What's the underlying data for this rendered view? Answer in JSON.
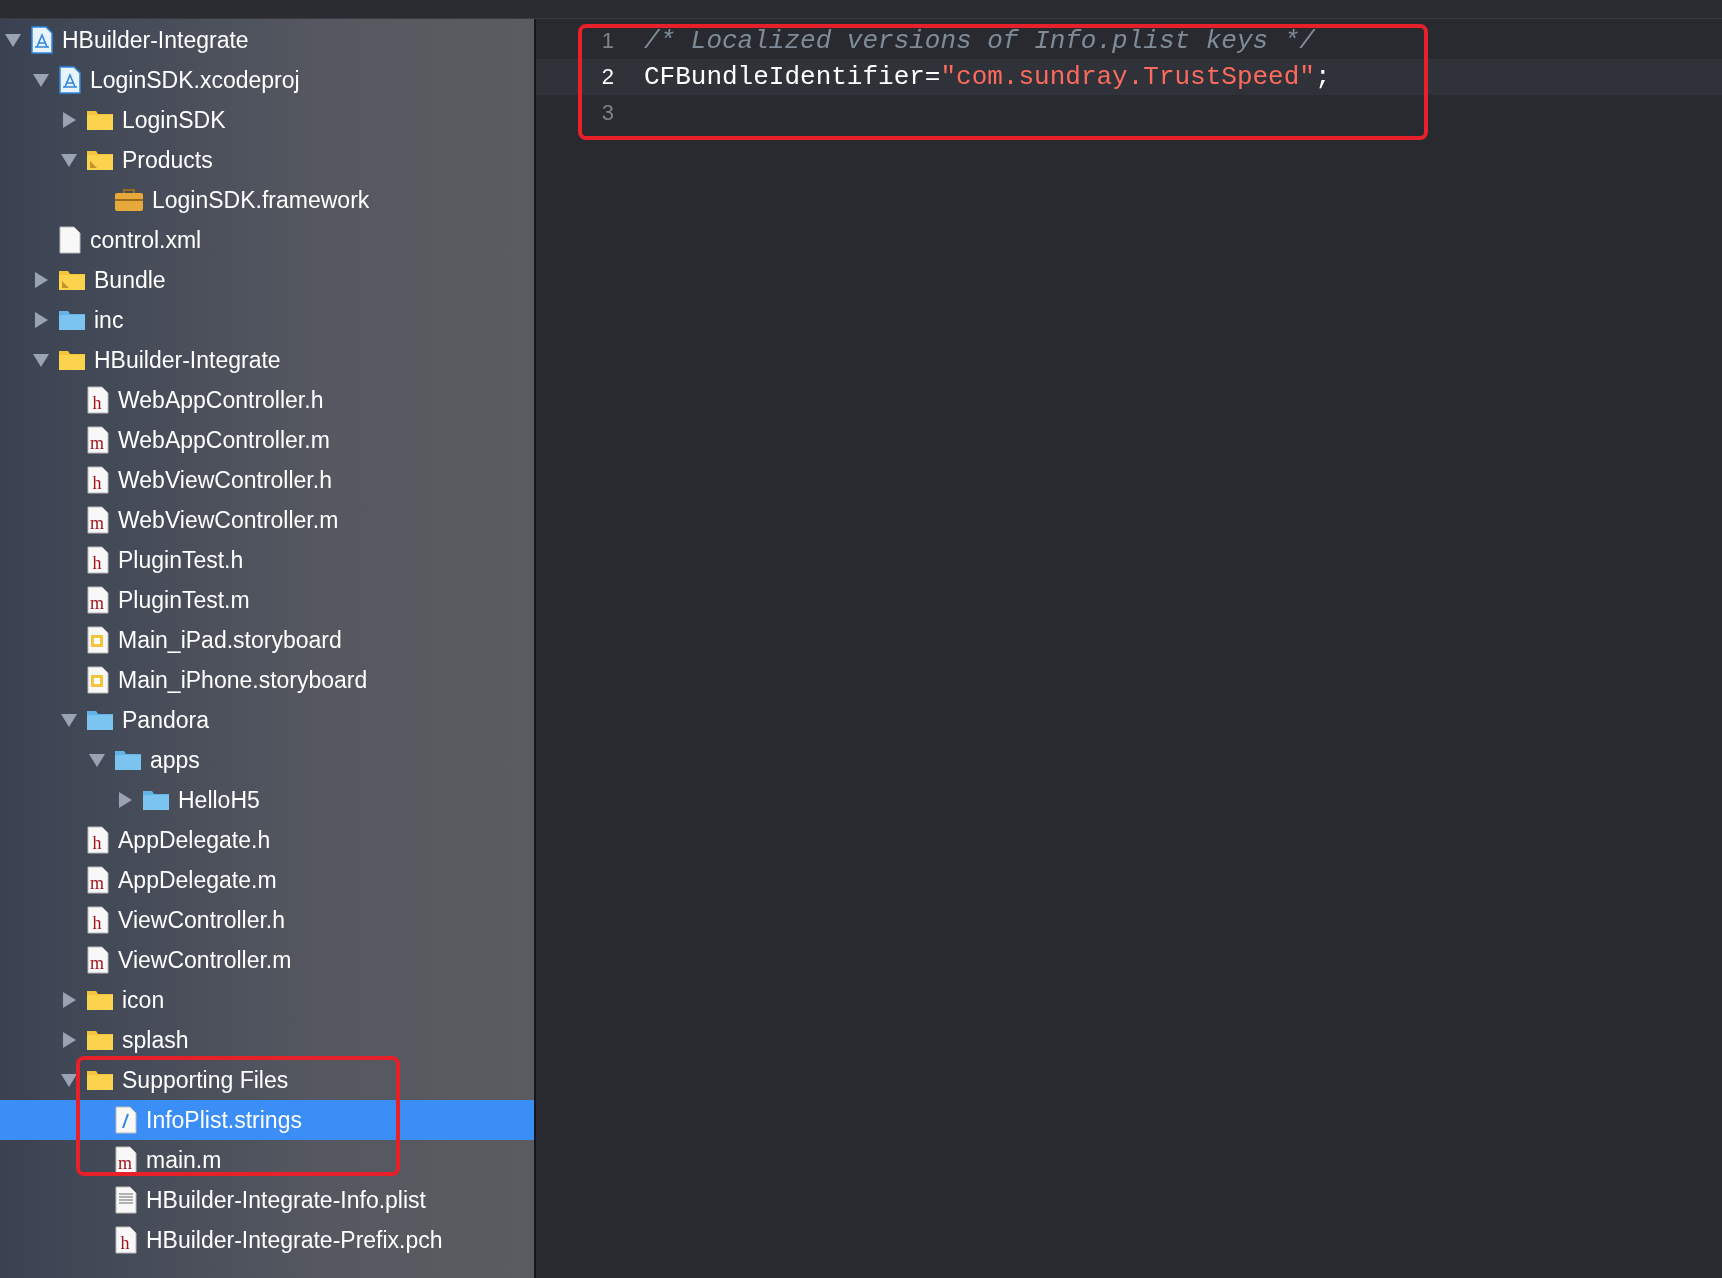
{
  "navigator": {
    "tree": [
      {
        "label": "HBuilder-Integrate",
        "kind": "project",
        "expanded": true,
        "selected": false,
        "children": [
          {
            "label": "LoginSDK.xcodeproj",
            "kind": "project",
            "expanded": true,
            "selected": false,
            "children": [
              {
                "label": "LoginSDK",
                "kind": "folder",
                "expanded": false,
                "selected": false
              },
              {
                "label": "Products",
                "kind": "group",
                "expanded": true,
                "selected": false,
                "children": [
                  {
                    "label": "LoginSDK.framework",
                    "kind": "framework",
                    "selected": false
                  }
                ]
              }
            ]
          },
          {
            "label": "control.xml",
            "kind": "file",
            "selected": false
          },
          {
            "label": "Bundle",
            "kind": "group",
            "expanded": false,
            "selected": false
          },
          {
            "label": "inc",
            "kind": "blue-folder",
            "expanded": false,
            "selected": false
          },
          {
            "label": "HBuilder-Integrate",
            "kind": "folder",
            "expanded": true,
            "selected": false,
            "children": [
              {
                "label": "WebAppController.h",
                "kind": "source",
                "icon_letter": "h",
                "selected": false
              },
              {
                "label": "WebAppController.m",
                "kind": "source",
                "icon_letter": "m",
                "selected": false
              },
              {
                "label": "WebViewController.h",
                "kind": "source",
                "icon_letter": "h",
                "selected": false
              },
              {
                "label": "WebViewController.m",
                "kind": "source",
                "icon_letter": "m",
                "selected": false
              },
              {
                "label": "PluginTest.h",
                "kind": "source",
                "icon_letter": "h",
                "selected": false
              },
              {
                "label": "PluginTest.m",
                "kind": "source",
                "icon_letter": "m",
                "selected": false
              },
              {
                "label": "Main_iPad.storyboard",
                "kind": "storyboard",
                "selected": false
              },
              {
                "label": "Main_iPhone.storyboard",
                "kind": "storyboard",
                "selected": false
              },
              {
                "label": "Pandora",
                "kind": "blue-folder",
                "expanded": true,
                "selected": false,
                "children": [
                  {
                    "label": "apps",
                    "kind": "blue-folder",
                    "expanded": true,
                    "selected": false,
                    "children": [
                      {
                        "label": "HelloH5",
                        "kind": "blue-folder",
                        "expanded": false,
                        "selected": false
                      }
                    ]
                  }
                ]
              },
              {
                "label": "AppDelegate.h",
                "kind": "source",
                "icon_letter": "h",
                "selected": false
              },
              {
                "label": "AppDelegate.m",
                "kind": "source",
                "icon_letter": "m",
                "selected": false
              },
              {
                "label": "ViewController.h",
                "kind": "source",
                "icon_letter": "h",
                "selected": false
              },
              {
                "label": "ViewController.m",
                "kind": "source",
                "icon_letter": "m",
                "selected": false
              },
              {
                "label": "icon",
                "kind": "folder",
                "expanded": false,
                "selected": false
              },
              {
                "label": "splash",
                "kind": "folder",
                "expanded": false,
                "selected": false
              },
              {
                "label": "Supporting Files",
                "kind": "folder",
                "expanded": true,
                "selected": false,
                "children": [
                  {
                    "label": "InfoPlist.strings",
                    "kind": "strings",
                    "selected": true
                  },
                  {
                    "label": "main.m",
                    "kind": "source",
                    "icon_letter": "m",
                    "selected": false
                  },
                  {
                    "label": "HBuilder-Integrate-Info.plist",
                    "kind": "plist",
                    "selected": false
                  },
                  {
                    "label": "HBuilder-Integrate-Prefix.pch",
                    "kind": "source",
                    "icon_letter": "h",
                    "selected": false
                  }
                ]
              }
            ]
          }
        ]
      }
    ]
  },
  "editor": {
    "lines": [
      {
        "number": "1",
        "current": false,
        "tokens": [
          {
            "kind": "comment",
            "text": "/* Localized versions of Info.plist keys */"
          }
        ]
      },
      {
        "number": "2",
        "current": true,
        "tokens": [
          {
            "kind": "plain",
            "text": "CFBundleIdentifier="
          },
          {
            "kind": "string",
            "text": "\"com.sundray.TrustSpeed\""
          },
          {
            "kind": "plain",
            "text": ";"
          }
        ]
      },
      {
        "number": "3",
        "current": false
      }
    ]
  }
}
